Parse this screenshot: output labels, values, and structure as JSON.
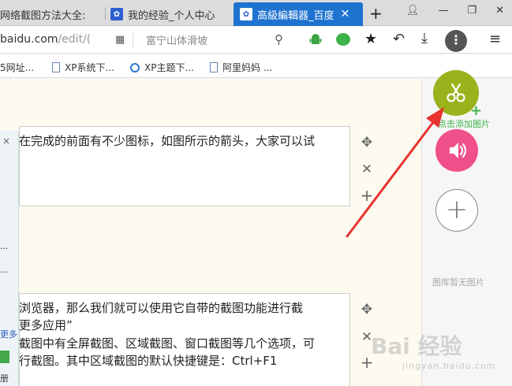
{
  "tabs": [
    {
      "label": "网络截图方法大全:"
    },
    {
      "label": "我的经验_个人中心"
    },
    {
      "label": "高級編輯器_百度"
    }
  ],
  "window": {
    "new_tab": "+"
  },
  "address": {
    "url_main": "baidu.com",
    "url_dim": "/edit/(",
    "search_placeholder": "富宁山体滑坡"
  },
  "bookmarks": [
    {
      "label": "5网址..."
    },
    {
      "label": "XP系统下..."
    },
    {
      "label": "XP主题下..."
    },
    {
      "label": "阿里妈妈 ..."
    }
  ],
  "editor": {
    "block1_line1": "在完成的前面有不少图标，如图所示的箭头，大家可以试",
    "block2_line1": "浏览器，那么我们就可以使用它自带的截图功能进行截",
    "block2_line2": "更多应用”",
    "block2_line3": "截图中有全屏截图、区域截图、窗口截图等几个选项，可",
    "block2_line4": "行截图。其中区域截图的默认快捷键是：Ctrl+F1"
  },
  "sidebar_strip": {
    "close": "×",
    "dots1": "...",
    "dots2": "...",
    "more": "更多",
    "char": "册"
  },
  "right_panel": {
    "add_image_label": "点击添加图片",
    "no_image_label": "图库暂无图片",
    "plus": "+"
  },
  "watermark": {
    "text": "Bai 经验",
    "sub": "jingyan.baidu.com"
  },
  "colors": {
    "scissor_button": "#9ab21c",
    "sound_button": "#f0508a",
    "arrow": "#e8322e",
    "active_tab": "#1e72d0"
  },
  "icons": [
    "scissors-icon",
    "speaker-icon",
    "plus-icon",
    "move-icon",
    "close-icon",
    "star-icon",
    "back-icon",
    "download-icon",
    "menu-icon",
    "search-icon",
    "android-icon",
    "wechat-icon"
  ]
}
